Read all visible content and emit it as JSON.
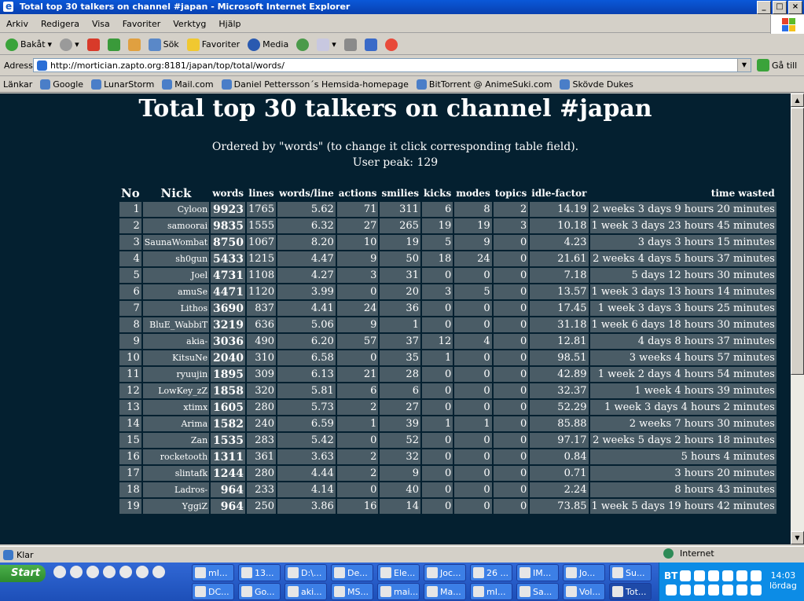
{
  "window": {
    "title": "Total top 30 talkers on channel #japan - Microsoft Internet Explorer"
  },
  "menu": [
    "Arkiv",
    "Redigera",
    "Visa",
    "Favoriter",
    "Verktyg",
    "Hjälp"
  ],
  "toolbar": {
    "back": "Bakåt",
    "search": "Sök",
    "favorites": "Favoriter",
    "media": "Media"
  },
  "address": {
    "label": "Adress",
    "url": "http://mortician.zapto.org:8181/japan/top/total/words/",
    "go": "Gå till"
  },
  "links": {
    "label": "Länkar",
    "items": [
      "Google",
      "LunarStorm",
      "Mail.com",
      "Daniel Pettersson´s Hemsida-homepage",
      "BitTorrent @ AnimeSuki.com",
      "Skövde Dukes"
    ]
  },
  "page": {
    "title": "Total top 30 talkers on channel #japan",
    "order_text": "Ordered by \"words\" (to change it click corresponding table field).",
    "peak_text": "User peak: 129",
    "headers": [
      "No",
      "Nick",
      "words",
      "lines",
      "words/line",
      "actions",
      "smilies",
      "kicks",
      "modes",
      "topics",
      "idle-factor",
      "time wasted"
    ],
    "rows": [
      [
        "1",
        "Cyloon",
        "9923",
        "1765",
        "5.62",
        "71",
        "311",
        "6",
        "8",
        "2",
        "14.19",
        "2 weeks 3 days 9 hours 20 minutes"
      ],
      [
        "2",
        "samoorai",
        "9835",
        "1555",
        "6.32",
        "27",
        "265",
        "19",
        "19",
        "3",
        "10.18",
        "1 week 3 days 23 hours 45 minutes"
      ],
      [
        "3",
        "SaunaWombat",
        "8750",
        "1067",
        "8.20",
        "10",
        "19",
        "5",
        "9",
        "0",
        "4.23",
        "3 days 3 hours 15 minutes"
      ],
      [
        "4",
        "sh0gun",
        "5433",
        "1215",
        "4.47",
        "9",
        "50",
        "18",
        "24",
        "0",
        "21.61",
        "2 weeks 4 days 5 hours 37 minutes"
      ],
      [
        "5",
        "Joel",
        "4731",
        "1108",
        "4.27",
        "3",
        "31",
        "0",
        "0",
        "0",
        "7.18",
        "5 days 12 hours 30 minutes"
      ],
      [
        "6",
        "amuSe",
        "4471",
        "1120",
        "3.99",
        "0",
        "20",
        "3",
        "5",
        "0",
        "13.57",
        "1 week 3 days 13 hours 14 minutes"
      ],
      [
        "7",
        "Lithos",
        "3690",
        "837",
        "4.41",
        "24",
        "36",
        "0",
        "0",
        "0",
        "17.45",
        "1 week 3 days 3 hours 25 minutes"
      ],
      [
        "8",
        "BluE_WabbiT",
        "3219",
        "636",
        "5.06",
        "9",
        "1",
        "0",
        "0",
        "0",
        "31.18",
        "1 week 6 days 18 hours 30 minutes"
      ],
      [
        "9",
        "akia-",
        "3036",
        "490",
        "6.20",
        "57",
        "37",
        "12",
        "4",
        "0",
        "12.81",
        "4 days 8 hours 37 minutes"
      ],
      [
        "10",
        "KitsuNe",
        "2040",
        "310",
        "6.58",
        "0",
        "35",
        "1",
        "0",
        "0",
        "98.51",
        "3 weeks 4 hours 57 minutes"
      ],
      [
        "11",
        "ryuujin",
        "1895",
        "309",
        "6.13",
        "21",
        "28",
        "0",
        "0",
        "0",
        "42.89",
        "1 week 2 days 4 hours 54 minutes"
      ],
      [
        "12",
        "LowKey_zZ",
        "1858",
        "320",
        "5.81",
        "6",
        "6",
        "0",
        "0",
        "0",
        "32.37",
        "1 week 4 hours 39 minutes"
      ],
      [
        "13",
        "xtimx",
        "1605",
        "280",
        "5.73",
        "2",
        "27",
        "0",
        "0",
        "0",
        "52.29",
        "1 week 3 days 4 hours 2 minutes"
      ],
      [
        "14",
        "Arima",
        "1582",
        "240",
        "6.59",
        "1",
        "39",
        "1",
        "1",
        "0",
        "85.88",
        "2 weeks 7 hours 30 minutes"
      ],
      [
        "15",
        "Zan",
        "1535",
        "283",
        "5.42",
        "0",
        "52",
        "0",
        "0",
        "0",
        "97.17",
        "2 weeks 5 days 2 hours 18 minutes"
      ],
      [
        "16",
        "rocketooth",
        "1311",
        "361",
        "3.63",
        "2",
        "32",
        "0",
        "0",
        "0",
        "0.84",
        "5 hours 4 minutes"
      ],
      [
        "17",
        "slintafk",
        "1244",
        "280",
        "4.44",
        "2",
        "9",
        "0",
        "0",
        "0",
        "0.71",
        "3 hours 20 minutes"
      ],
      [
        "18",
        "Ladros-",
        "964",
        "233",
        "4.14",
        "0",
        "40",
        "0",
        "0",
        "0",
        "2.24",
        "8 hours 43 minutes"
      ],
      [
        "19",
        "YggiZ",
        "964",
        "250",
        "3.86",
        "16",
        "14",
        "0",
        "0",
        "0",
        "73.85",
        "1 week 5 days 19 hours 42 minutes"
      ]
    ]
  },
  "status": {
    "text": "Klar",
    "zone": "Internet"
  },
  "taskbar": {
    "start": "Start",
    "tasks": [
      "mI...",
      "13...",
      "D:\\...",
      "De...",
      "Ele...",
      "Joc...",
      "26 ...",
      "IM...",
      "Jo...",
      "Su...",
      "DC...",
      "Go...",
      "aki...",
      "MS...",
      "mai...",
      "Ma...",
      "mI...",
      "Sa...",
      "Vol...",
      "Tot..."
    ],
    "tray_label": "BT",
    "time": "14:03",
    "day": "lördag"
  },
  "colors": {
    "page_bg": "#042030",
    "cell_bg": "#4a5c66",
    "title_blue": "#0a58d8"
  }
}
